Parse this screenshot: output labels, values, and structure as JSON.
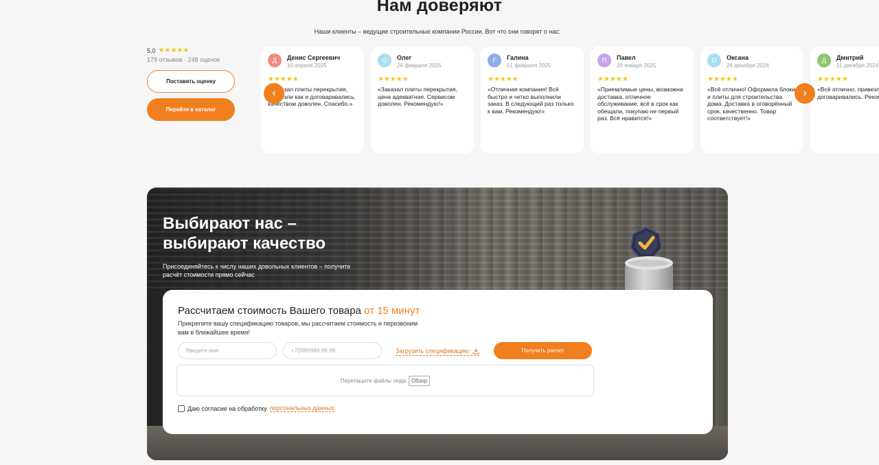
{
  "section": {
    "title": "Нам доверяют",
    "subtitle": "Наши клиенты – ведущие строительные компании России. Вот что они говорят о нас:"
  },
  "rating": {
    "score": "5,0",
    "stars": "★★★★★",
    "reviews_count": "179 отзывов",
    "separator": "·",
    "ratings_count": "248 оценок",
    "rate_button": "Поставить оценку",
    "catalog_button": "Перейти в каталог"
  },
  "reviews": [
    {
      "initial": "Д",
      "name": "Денис Сергеевич",
      "date": "10 апреля 2025",
      "stars": "★★★★★",
      "text": "«Заказал плиты перекрытия, привезли как и договаривались, качеством доволен. Спасибо.»",
      "color": "#f08a80"
    },
    {
      "initial": "О",
      "name": "Олег",
      "date": "26 февраля 2025",
      "stars": "★★★★★",
      "text": "«Заказал плиты перекрытия, цена адекватная. Сервисом доволен. Рекомендую!»",
      "color": "#a8dff0"
    },
    {
      "initial": "Г",
      "name": "Галина",
      "date": "01 февраля 2025",
      "stars": "★★★★★",
      "text": "«Отличная компания! Всё быстро и четко выполнили заказ. В следующий раз только к вам. Рекомендую!»",
      "color": "#8faee8"
    },
    {
      "initial": "П",
      "name": "Павел",
      "date": "20 января 2025",
      "stars": "★★★★★",
      "text": "«Приемлимые цены, возможна доставка, отличное обслуживание, всё в срок как обещали, покупаю не первый раз. Всё нравится!»",
      "color": "#c9a2ec"
    },
    {
      "initial": "О",
      "name": "Оксана",
      "date": "26 декабря 2024",
      "stars": "★★★★★",
      "text": "«Всё отлично! Оформила блоки и плиты для строительства дома. Доставка в оговорённый срок, качественно. Товар соответствует!»",
      "color": "#a8dff0"
    },
    {
      "initial": "Д",
      "name": "Дмитрий",
      "date": "11 декабря 2024",
      "stars": "★★★★★",
      "text": "«Всё отлично, привезли как договаривались. Рекомендую.»",
      "color": "#8cc66e"
    }
  ],
  "carousel": {
    "prev_icon": "chevron-left-icon",
    "next_icon": "chevron-right-icon",
    "prev_glyph": "‹",
    "next_glyph": "›"
  },
  "promo": {
    "title_line1": "Выбирают нас –",
    "title_line2": "выбирают качество",
    "description": "Присоединяйтесь к числу наших довольных клиентов – получите расчёт стоимости прямо сейчас"
  },
  "form": {
    "title": "Рассчитаем стоимость Вашего товара",
    "title_accent": "от 15 минут",
    "description": "Прикрепите вашу спецификацию товаров, мы рассчитаем стоимость и перезвоним вам в ближайшее время!",
    "name_placeholder": "Введите имя",
    "phone_placeholder": "+7(999)999-99-99",
    "upload_label": "Загрузить спецификацию",
    "submit_label": "Получить расчет",
    "dropzone_text": "Перетащите файлы сюда",
    "browse_label": "Обзор",
    "consent_text": "Даю согласие на обработку",
    "consent_link": "персональных данных"
  },
  "colors": {
    "accent": "#f07f1f",
    "star": "#f5c518"
  }
}
